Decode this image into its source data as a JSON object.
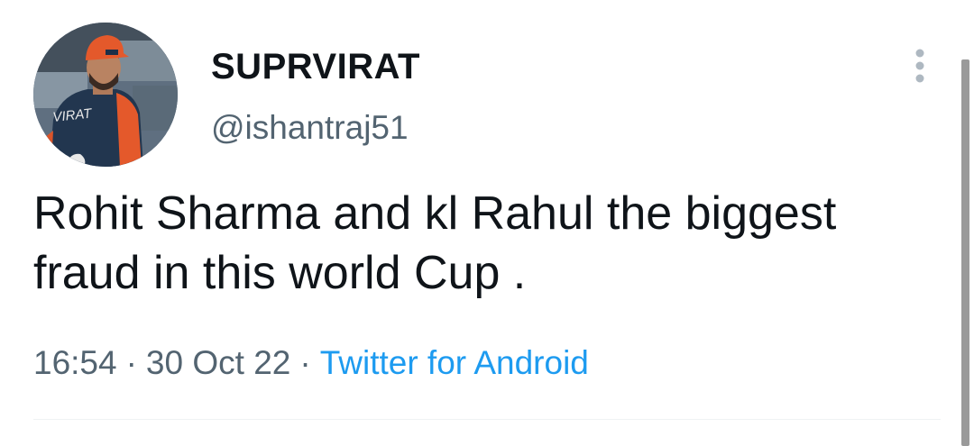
{
  "tweet": {
    "author": {
      "display_name": "SUPRVIRAT",
      "handle": "@ishantraj51",
      "avatar_icon": "profile-photo",
      "avatar_jersey_text": "VIRAT"
    },
    "text": "Rohit Sharma and kl Rahul the biggest fraud in this world Cup .",
    "time": "16:54",
    "date": "30 Oct 22",
    "separator": "·",
    "source": "Twitter for Android",
    "more_icon": "more-vertical-icon"
  },
  "colors": {
    "text_primary": "#0f1419",
    "text_secondary": "#536471",
    "link": "#1d9bf0",
    "divider": "#eff3f4"
  }
}
